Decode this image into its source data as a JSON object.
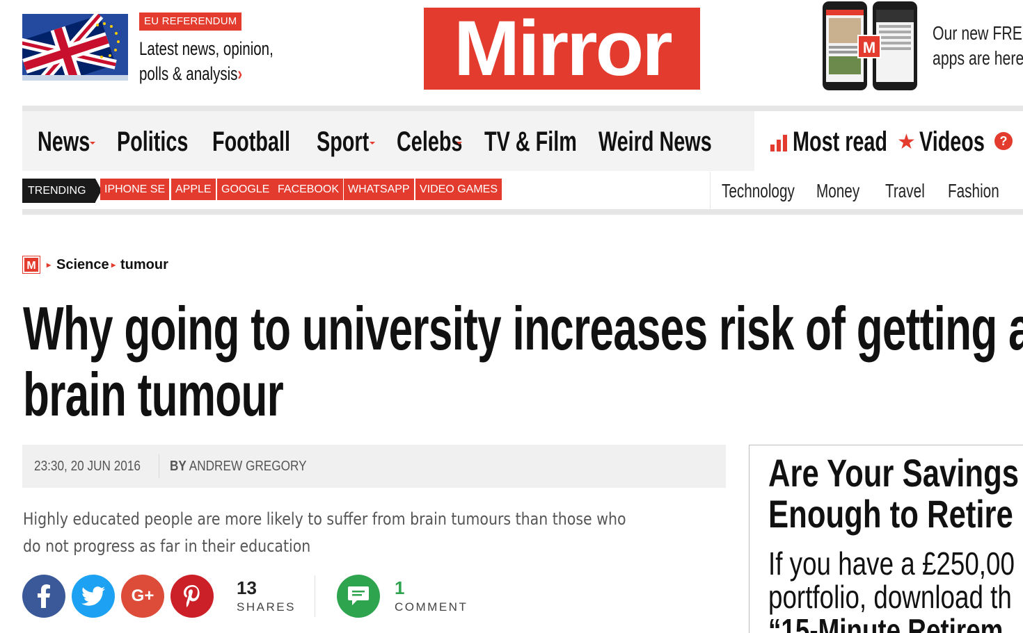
{
  "colors": {
    "brand_red": "#e33b2e",
    "comment_green": "#2ea44f",
    "facebook": "#3b5998",
    "twitter": "#1da1f2",
    "google_plus": "#dd4b39",
    "pinterest": "#cb2027"
  },
  "header": {
    "referendum": {
      "badge": "EU REFERENDUM",
      "line1": "Latest news, opinion,",
      "line2": "polls & analysis",
      "arrow": "›"
    },
    "logo": "Mirror",
    "apps": {
      "line1": "Our new FREE",
      "line2": "apps are here",
      "app_icon": "M"
    }
  },
  "nav": {
    "items": [
      {
        "label": "News",
        "dropdown": true
      },
      {
        "label": "Politics",
        "dropdown": false
      },
      {
        "label": "Football",
        "dropdown": false
      },
      {
        "label": "Sport",
        "dropdown": true
      },
      {
        "label": "Celebs",
        "dropdown": true
      },
      {
        "label": "TV & Film",
        "dropdown": false
      },
      {
        "label": "Weird News",
        "dropdown": false
      }
    ],
    "right": [
      {
        "label": "Most read",
        "icon": "bar-chart-icon"
      },
      {
        "label": "Videos",
        "icon": "star-icon"
      },
      {
        "label": "",
        "icon": "question-icon"
      }
    ]
  },
  "trending": {
    "label": "TRENDING",
    "tags": [
      "IPHONE SE",
      "APPLE",
      "GOOGLE",
      "FACEBOOK",
      "WHATSAPP",
      "VIDEO GAMES"
    ]
  },
  "subnav": [
    "Technology",
    "Money",
    "Travel",
    "Fashion"
  ],
  "breadcrumb": {
    "home_icon": "M",
    "items": [
      "Science",
      "tumour"
    ]
  },
  "article": {
    "headline_line1": "Why going to university increases risk of getting a",
    "headline_line2": "brain tumour",
    "date": "23:30, 20 JUN 2016",
    "by": "BY",
    "author": "ANDREW GREGORY",
    "standfirst_line1": "Highly educated people are more likely to suffer from brain tumours than those who",
    "standfirst_line2": "do not progress as far in their education"
  },
  "share": {
    "count": "13",
    "count_label": "SHARES",
    "comments": "1",
    "comments_label": "COMMENT",
    "networks": [
      "facebook-icon",
      "twitter-icon",
      "google-plus-icon",
      "pinterest-icon"
    ]
  },
  "ad": {
    "title_line1": "Are Your Savings",
    "title_line2": "Enough to Retire",
    "body_line1": "If you have a £250,00",
    "body_line2": "portfolio, download th",
    "body_line3": "“15-Minute Retirem"
  }
}
